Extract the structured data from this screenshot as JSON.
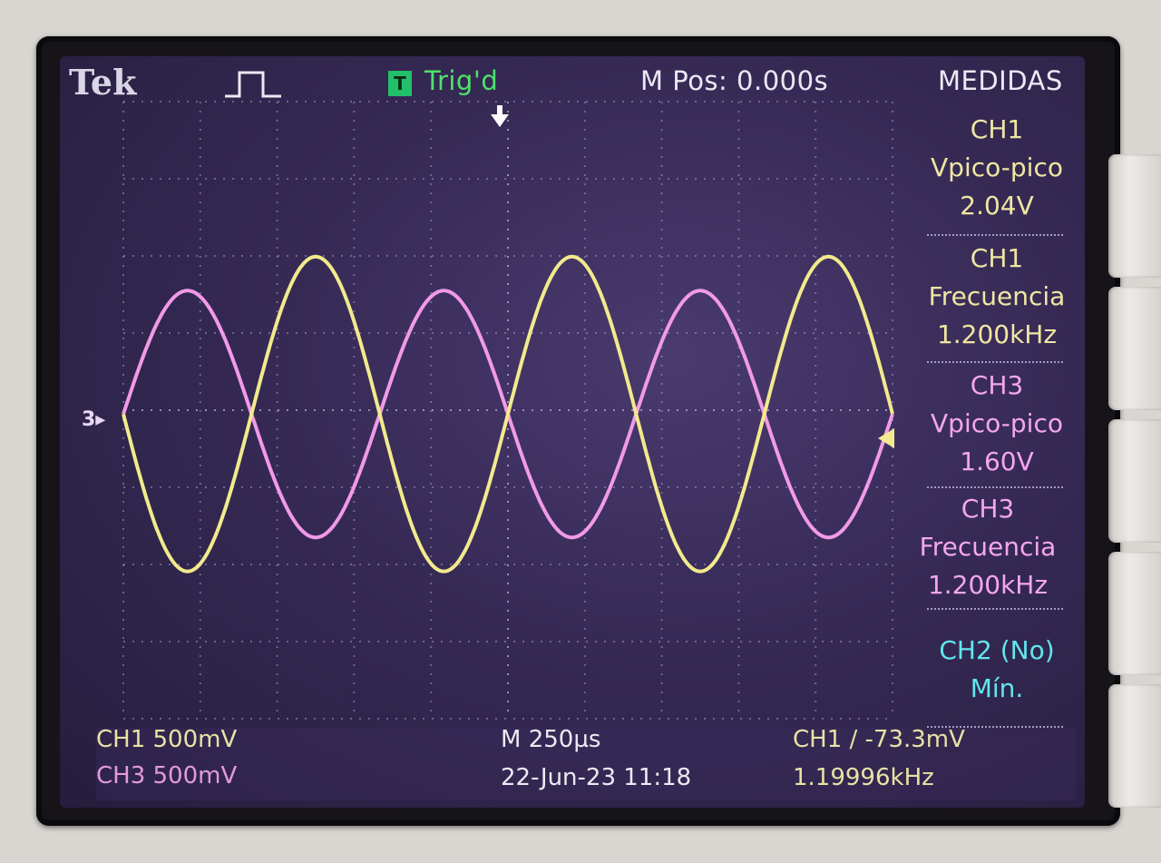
{
  "header": {
    "brand": "Tek",
    "trigger_icon": "T",
    "trigger_status": "Trig'd",
    "position": "M Pos: 0.000s",
    "menu_title": "MEDIDAS"
  },
  "measurements": [
    {
      "channel": "CH1",
      "label": "Vpico-pico",
      "value": "2.04V"
    },
    {
      "channel": "CH1",
      "label": "Frecuencia",
      "value": "1.200kHz"
    },
    {
      "channel": "CH3",
      "label": "Vpico-pico",
      "value": "1.60V"
    },
    {
      "channel": "CH3",
      "label": "Frecuencia",
      "value": "1.200kHz"
    },
    {
      "channel": "CH2 (No)",
      "label": "Mín.",
      "value": ""
    }
  ],
  "footer": {
    "ch1_scale": "CH1  500mV",
    "ch3_scale": "CH3  500mV",
    "timebase": "M 250µs",
    "datetime": "22-Jun-23 11:18",
    "trigger_setting": "CH1 ∕ -73.3mV",
    "trigger_freq": "1.19996kHz"
  },
  "markers": {
    "ch3_ground": "3▸"
  },
  "colors": {
    "ch1": "#f2ea8c",
    "ch3": "#f19ae8",
    "ch2": "#62e6ee",
    "trigger": "#4de36a"
  },
  "chart_data": {
    "type": "line",
    "xlabel": "",
    "ylabel": "",
    "x_divisions": 10,
    "y_divisions": 8,
    "time_per_div_us": 250,
    "volts_per_div_mV": 500,
    "series": [
      {
        "name": "CH1",
        "peak_to_peak_V": 2.04,
        "frequency_kHz": 1.2,
        "phase_deg": 180
      },
      {
        "name": "CH3",
        "peak_to_peak_V": 1.6,
        "frequency_kHz": 1.2,
        "phase_deg": 0
      }
    ]
  }
}
